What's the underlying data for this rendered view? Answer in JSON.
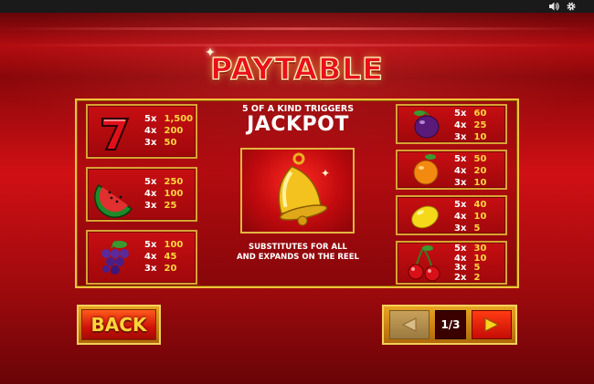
{
  "topbar": {
    "icons": [
      "speaker-icon",
      "gear-icon"
    ]
  },
  "title": "PAYTABLE",
  "left_symbols": [
    {
      "symbol": "seven",
      "pays": [
        {
          "mult": "5x",
          "value": "1,500"
        },
        {
          "mult": "4x",
          "value": "200"
        },
        {
          "mult": "3x",
          "value": "50"
        }
      ]
    },
    {
      "symbol": "watermelon",
      "pays": [
        {
          "mult": "5x",
          "value": "250"
        },
        {
          "mult": "4x",
          "value": "100"
        },
        {
          "mult": "3x",
          "value": "25"
        }
      ]
    },
    {
      "symbol": "grapes",
      "pays": [
        {
          "mult": "5x",
          "value": "100"
        },
        {
          "mult": "4x",
          "value": "45"
        },
        {
          "mult": "3x",
          "value": "20"
        }
      ]
    }
  ],
  "right_symbols": [
    {
      "symbol": "plum",
      "pays": [
        {
          "mult": "5x",
          "value": "60"
        },
        {
          "mult": "4x",
          "value": "25"
        },
        {
          "mult": "3x",
          "value": "10"
        }
      ]
    },
    {
      "symbol": "orange",
      "pays": [
        {
          "mult": "5x",
          "value": "50"
        },
        {
          "mult": "4x",
          "value": "20"
        },
        {
          "mult": "3x",
          "value": "10"
        }
      ]
    },
    {
      "symbol": "lemon",
      "pays": [
        {
          "mult": "5x",
          "value": "40"
        },
        {
          "mult": "4x",
          "value": "10"
        },
        {
          "mult": "3x",
          "value": "5"
        }
      ]
    },
    {
      "symbol": "cherries",
      "pays": [
        {
          "mult": "5x",
          "value": "30"
        },
        {
          "mult": "4x",
          "value": "10"
        },
        {
          "mult": "3x",
          "value": "5"
        },
        {
          "mult": "2x",
          "value": "2"
        }
      ]
    }
  ],
  "jackpot": {
    "triggers_text": "5 OF A KIND TRIGGERS",
    "label": "JACKPOT",
    "symbol": "bell",
    "wild_line1": "SUBSTITUTES FOR ALL",
    "wild_line2": "AND EXPANDS ON THE REEL"
  },
  "buttons": {
    "back_label": "BACK",
    "page_indicator": "1/3"
  },
  "colors": {
    "background_red": "#b30c10",
    "gold": "#f2c23c",
    "pay_value": "#ffd640",
    "title_red": "#e8101a"
  }
}
